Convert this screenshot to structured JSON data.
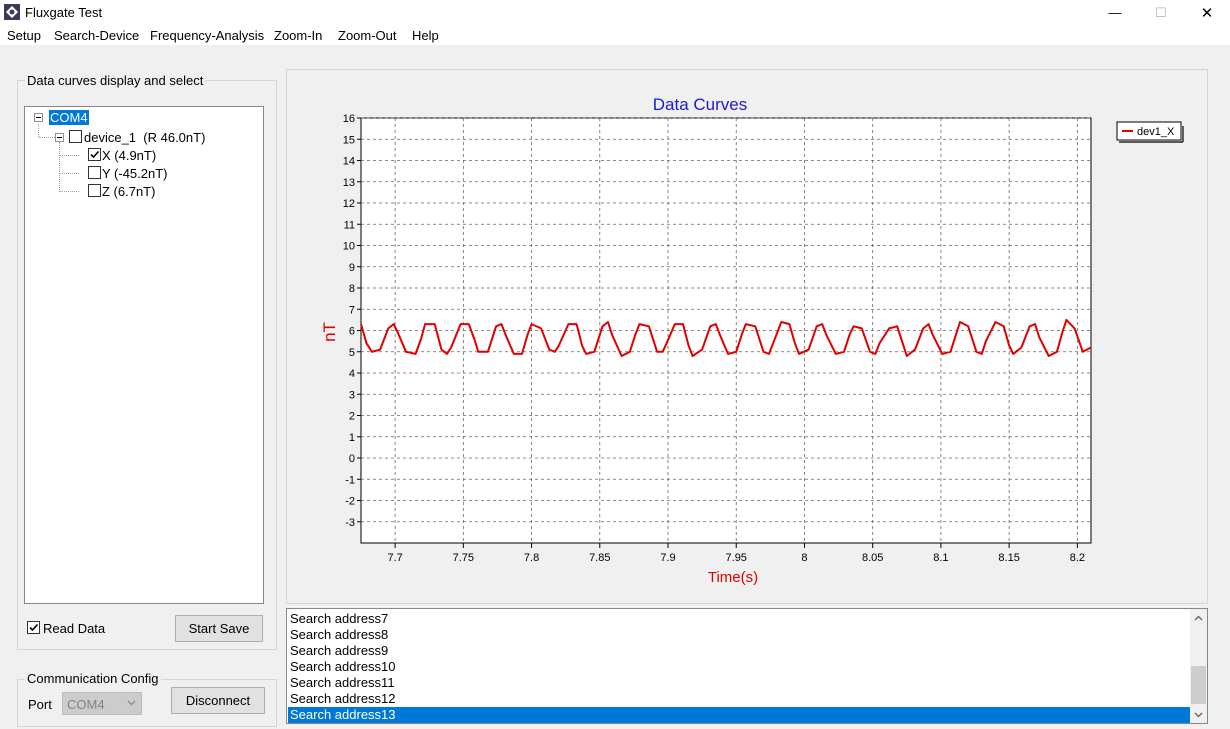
{
  "window": {
    "title": "Fluxgate Test",
    "controls": {
      "minimize": "—",
      "maximize": "☐",
      "close": "✕"
    }
  },
  "menu": [
    "Setup",
    "Search-Device",
    "Frequency-Analysis",
    "Zoom-In",
    "Zoom-Out",
    "Help"
  ],
  "left_panel": {
    "group_title": "Data curves display and select",
    "tree": {
      "root": "COM4",
      "device": {
        "label": "device_1",
        "reading": "(R 46.0nT)",
        "checked": false
      },
      "channels": [
        {
          "label": "X (4.9nT)",
          "checked": true
        },
        {
          "label": "Y (-45.2nT)",
          "checked": false
        },
        {
          "label": "Z (6.7nT)",
          "checked": false
        }
      ]
    },
    "read_data": {
      "label": "Read Data",
      "checked": true
    },
    "start_save_label": "Start Save"
  },
  "comm": {
    "group_title": "Communication Config",
    "port_label": "Port",
    "port_value": "COM4",
    "disconnect_label": "Disconnect"
  },
  "chart_data": {
    "type": "line",
    "title": "Data Curves",
    "xlabel": "Time(s)",
    "ylabel": "nT",
    "xlim": [
      7.675,
      8.21
    ],
    "ylim": [
      -4,
      16
    ],
    "x_ticks": [
      7.7,
      7.75,
      7.8,
      7.85,
      7.9,
      7.95,
      8,
      8.05,
      8.1,
      8.15,
      8.2
    ],
    "y_ticks": [
      16,
      15,
      14,
      13,
      12,
      11,
      10,
      9,
      8,
      7,
      6,
      5,
      4,
      3,
      2,
      1,
      0,
      -1,
      -2,
      -3
    ],
    "grid": true,
    "legend_position": "top-right, outside plot area",
    "series": [
      {
        "name": "dev1_X",
        "color": "#e00000",
        "x": [
          7.675,
          7.679,
          7.683,
          7.689,
          7.695,
          7.699,
          7.702,
          7.708,
          7.715,
          7.719,
          7.722,
          7.729,
          7.734,
          7.738,
          7.741,
          7.748,
          7.754,
          7.758,
          7.761,
          7.768,
          7.774,
          7.778,
          7.781,
          7.787,
          7.793,
          7.797,
          7.8,
          7.807,
          7.813,
          7.817,
          7.82,
          7.827,
          7.833,
          7.837,
          7.84,
          7.846,
          7.852,
          7.856,
          7.859,
          7.866,
          7.872,
          7.876,
          7.879,
          7.886,
          7.892,
          7.896,
          7.899,
          7.905,
          7.911,
          7.915,
          7.918,
          7.925,
          7.931,
          7.935,
          7.938,
          7.944,
          7.95,
          7.954,
          7.957,
          7.964,
          7.97,
          7.974,
          7.977,
          7.983,
          7.989,
          7.993,
          7.996,
          8.003,
          8.009,
          8.013,
          8.016,
          8.023,
          8.029,
          8.033,
          8.036,
          8.042,
          8.048,
          8.052,
          8.055,
          8.062,
          8.068,
          8.072,
          8.075,
          8.081,
          8.087,
          8.091,
          8.094,
          8.101,
          8.107,
          8.111,
          8.114,
          8.12,
          8.126,
          8.13,
          8.133,
          8.14,
          8.146,
          8.15,
          8.153,
          8.159,
          8.165,
          8.169,
          8.172,
          8.179,
          8.185,
          8.189,
          8.192,
          8.198,
          8.204,
          8.21
        ],
        "y": [
          6.3,
          5.4,
          5.0,
          5.1,
          6.1,
          6.3,
          5.9,
          5.0,
          4.9,
          5.6,
          6.3,
          6.3,
          5.1,
          4.9,
          5.2,
          6.3,
          6.3,
          5.6,
          5.0,
          5.0,
          6.2,
          6.3,
          5.8,
          4.9,
          4.9,
          5.8,
          6.3,
          6.1,
          5.1,
          5.0,
          5.3,
          6.3,
          6.3,
          5.3,
          4.9,
          5.0,
          6.2,
          6.4,
          5.8,
          4.8,
          5.0,
          5.8,
          6.3,
          6.2,
          5.0,
          5.0,
          5.4,
          6.3,
          6.3,
          5.3,
          4.8,
          5.1,
          6.2,
          6.3,
          5.8,
          4.9,
          5.0,
          5.8,
          6.3,
          6.2,
          5.0,
          4.9,
          5.4,
          6.4,
          6.3,
          5.4,
          4.9,
          5.1,
          6.2,
          6.3,
          5.8,
          4.9,
          5.0,
          5.8,
          6.2,
          6.1,
          5.0,
          4.9,
          5.4,
          6.1,
          6.2,
          5.4,
          4.8,
          5.1,
          6.1,
          6.3,
          5.8,
          4.9,
          5.0,
          5.8,
          6.4,
          6.2,
          5.0,
          4.9,
          5.5,
          6.4,
          6.2,
          5.3,
          4.9,
          5.2,
          6.2,
          6.3,
          5.7,
          4.8,
          5.0,
          5.9,
          6.5,
          6.1,
          5.0,
          5.2
        ]
      }
    ]
  },
  "log": {
    "lines": [
      "Search address7",
      "Search address8",
      "Search address9",
      "Search address10",
      "Search address11",
      "Search address12",
      "Search address13"
    ],
    "selected_index": 6
  }
}
